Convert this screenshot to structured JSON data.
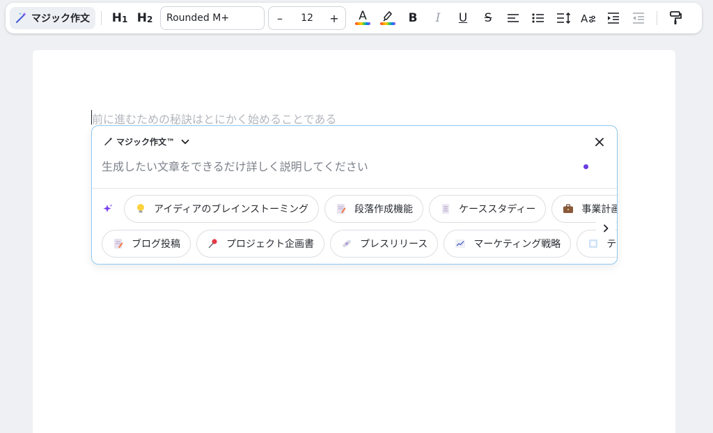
{
  "toolbar": {
    "magic_label": "マジック作文",
    "h1_label": "H",
    "h1_sub": "1",
    "h2_label": "H",
    "h2_sub": "2",
    "font_name": "Rounded M+",
    "font_size": "12",
    "minus": "–",
    "plus": "+",
    "text_color_letter": "A",
    "bold": "B",
    "italic": "I",
    "underline": "U",
    "strike": "S"
  },
  "document": {
    "placeholder": "前に進むための秘訣はとにかく始めることである"
  },
  "magic_panel": {
    "title": "マジック作文™",
    "input_placeholder": "生成したい文章をできるだけ詳しく説明してください",
    "row1": [
      {
        "icon": "lightbulb-icon",
        "label": "アイディアのブレインストーミング"
      },
      {
        "icon": "memo-icon",
        "label": "段落作成機能"
      },
      {
        "icon": "document-icon",
        "label": "ケーススタディー"
      },
      {
        "icon": "briefcase-icon",
        "label": "事業計画"
      }
    ],
    "row2": [
      {
        "icon": "memo-icon",
        "label": "ブログ投稿"
      },
      {
        "icon": "pin-icon",
        "label": "プロジェクト企画書"
      },
      {
        "icon": "bandage-icon",
        "label": "プレスリリース"
      },
      {
        "icon": "chart-icon",
        "label": "マーケティング戦略"
      },
      {
        "icon": "frame-icon",
        "label": "テキスト"
      }
    ]
  },
  "colors": {
    "accent": "#6a3ce0",
    "panel_border": "#8fc9f2"
  }
}
